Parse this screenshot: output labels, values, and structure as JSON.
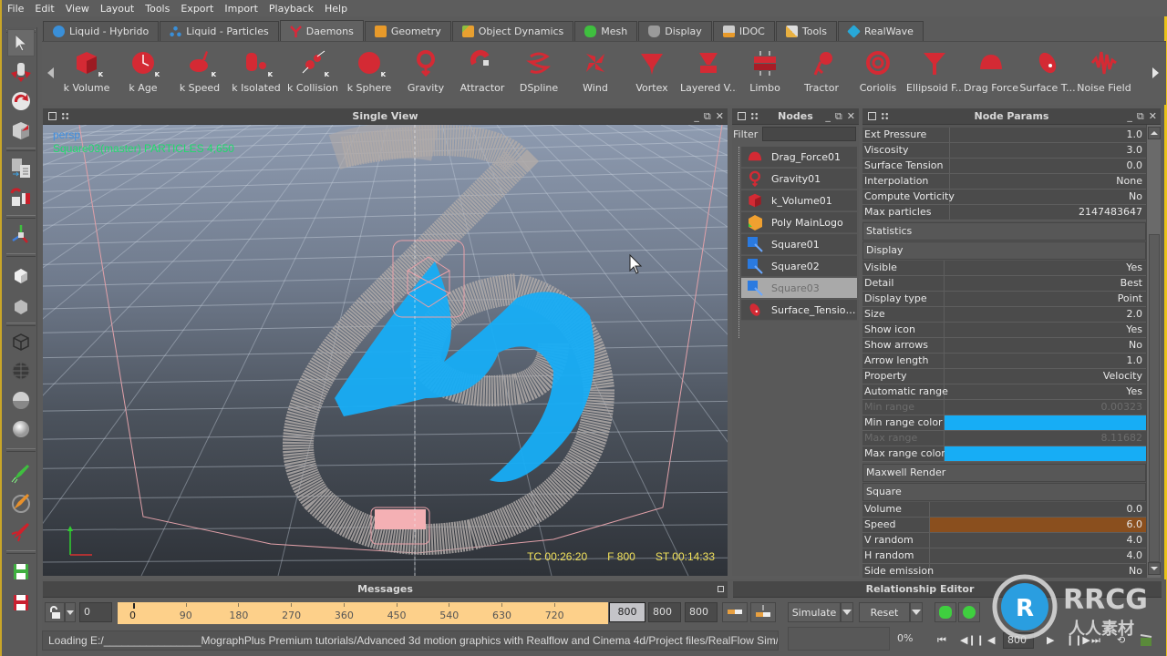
{
  "menu": [
    "File",
    "Edit",
    "View",
    "Layout",
    "Tools",
    "Export",
    "Import",
    "Playback",
    "Help"
  ],
  "tabs": [
    {
      "label": "Liquid - Hybrido",
      "icon": "hybrido-icon",
      "color": "#3a8fd8"
    },
    {
      "label": "Liquid - Particles",
      "icon": "particles-icon",
      "color": "#3a8fd8"
    },
    {
      "label": "Daemons",
      "icon": "daemons-icon",
      "color": "#d8283a",
      "active": true
    },
    {
      "label": "Geometry",
      "icon": "geometry-icon",
      "color": "#e89a2a"
    },
    {
      "label": "Object Dynamics",
      "icon": "object-dynamics-icon",
      "color": "#e8a030"
    },
    {
      "label": "Mesh",
      "icon": "mesh-icon",
      "color": "#3fbf3f"
    },
    {
      "label": "Display",
      "icon": "display-icon",
      "color": "#9a9a9a"
    },
    {
      "label": "IDOC",
      "icon": "idoc-icon",
      "color": "#bdbdbd"
    },
    {
      "label": "Tools",
      "icon": "tools-icon",
      "color": "#e8b040"
    },
    {
      "label": "RealWave",
      "icon": "realwave-icon",
      "color": "#28a8d8"
    }
  ],
  "daemons": [
    {
      "label": "k Volume",
      "icon": "k-volume-icon",
      "k": true
    },
    {
      "label": "k Age",
      "icon": "k-age-icon",
      "k": true
    },
    {
      "label": "k Speed",
      "icon": "k-speed-icon",
      "k": true
    },
    {
      "label": "k Isolated",
      "icon": "k-isolated-icon",
      "k": true
    },
    {
      "label": "k Collision",
      "icon": "k-collision-icon",
      "k": true
    },
    {
      "label": "k Sphere",
      "icon": "k-sphere-icon",
      "k": true
    },
    {
      "label": "Gravity",
      "icon": "gravity-icon"
    },
    {
      "label": "Attractor",
      "icon": "attractor-icon"
    },
    {
      "label": "DSpline",
      "icon": "dspline-icon"
    },
    {
      "label": "Wind",
      "icon": "wind-icon"
    },
    {
      "label": "Vortex",
      "icon": "vortex-icon"
    },
    {
      "label": "Layered V...",
      "icon": "layered-vortex-icon"
    },
    {
      "label": "Limbo",
      "icon": "limbo-icon"
    },
    {
      "label": "Tractor",
      "icon": "tractor-icon"
    },
    {
      "label": "Coriolis",
      "icon": "coriolis-icon"
    },
    {
      "label": "Ellipsoid F...",
      "icon": "ellipsoid-force-icon"
    },
    {
      "label": "Drag Force",
      "icon": "drag-force-icon"
    },
    {
      "label": "Surface T...",
      "icon": "surface-tension-icon"
    },
    {
      "label": "Noise Field",
      "icon": "noise-field-icon"
    }
  ],
  "k_badge": "K",
  "viewport": {
    "title": "Single View",
    "camera": "persp",
    "particles_info": "Square03(master) PARTICLES 4,650",
    "timecode": "TC 00:26:20",
    "frame": "F 800",
    "sim_time": "ST 00:14:33"
  },
  "nodes": {
    "title": "Nodes",
    "filter_label": "Filter",
    "filter_value": "",
    "items": [
      {
        "label": "Drag_Force01",
        "icon": "drag-force-icon"
      },
      {
        "label": "Gravity01",
        "icon": "gravity-icon"
      },
      {
        "label": "k_Volume01",
        "icon": "k-volume-icon"
      },
      {
        "label": "Poly MainLogo",
        "icon": "poly-object-icon"
      },
      {
        "label": "Square01",
        "icon": "square-emitter-icon"
      },
      {
        "label": "Square02",
        "icon": "square-emitter-icon"
      },
      {
        "label": "Square03",
        "icon": "square-emitter-icon",
        "selected": true
      },
      {
        "label": "Surface_Tension...",
        "icon": "surface-tension-icon"
      }
    ]
  },
  "params": {
    "title": "Node Params",
    "rows_top": [
      {
        "key": "Ext Pressure",
        "value": "1.0"
      },
      {
        "key": "Viscosity",
        "value": "3.0"
      },
      {
        "key": "Surface Tension",
        "value": "0.0"
      },
      {
        "key": "Interpolation",
        "value": "None"
      },
      {
        "key": "Compute Vorticity",
        "value": "No"
      },
      {
        "key": "Max particles",
        "value": "2147483647"
      }
    ],
    "section_statistics": "Statistics",
    "section_display": "Display",
    "rows_display": [
      {
        "key": "Visible",
        "value": "Yes"
      },
      {
        "key": "Detail",
        "value": "Best"
      },
      {
        "key": "Display type",
        "value": "Point"
      },
      {
        "key": "Size",
        "value": "2.0"
      },
      {
        "key": "Show icon",
        "value": "Yes"
      },
      {
        "key": "Show arrows",
        "value": "No"
      },
      {
        "key": "Arrow length",
        "value": "1.0"
      },
      {
        "key": "Property",
        "value": "Velocity"
      },
      {
        "key": "Automatic range",
        "value": "Yes"
      },
      {
        "key": "Min range",
        "value": "0.00323",
        "dim": true
      },
      {
        "key": "Min range color",
        "value": "",
        "color": "#17adf5"
      },
      {
        "key": "Max range",
        "value": "8.11682",
        "dim": true
      },
      {
        "key": "Max range color",
        "value": "",
        "color": "#17adf5"
      }
    ],
    "section_maxwell": "Maxwell Render",
    "section_square": "Square",
    "rows_square": [
      {
        "key": "Volume",
        "value": "0.0"
      },
      {
        "key": "Speed",
        "value": "6.0",
        "highlight": "#8a4f1e"
      },
      {
        "key": "V random",
        "value": "4.0"
      },
      {
        "key": "H random",
        "value": "4.0"
      },
      {
        "key": "Side emission",
        "value": "No"
      }
    ]
  },
  "messages": {
    "title": "Messages"
  },
  "relationship": {
    "title": "Relationship Editor"
  },
  "timeline": {
    "start_field": "0",
    "ticks": [
      "0",
      "90",
      "180",
      "270",
      "360",
      "450",
      "540",
      "630",
      "720"
    ],
    "current_frame": "800",
    "end_field_1": "800",
    "end_field_2": "800"
  },
  "sim": {
    "simulate_label": "Simulate",
    "reset_label": "Reset",
    "progress": "0%",
    "frame_field": "800"
  },
  "status": {
    "text": "Loading E:/________________MographPlus Premium tutorials/Advanced 3d motion graphics with Realflow and Cinema 4d/Project files/RealFlow Sim/Fluid Sim..."
  },
  "watermark": {
    "brand": "RRCG",
    "subtitle": "人人素材"
  },
  "colors": {
    "accent_daemon_red": "#d42a34",
    "particle_blue": "#17adf5",
    "particle_grey": "#b0aaa8",
    "timeline_orange": "#fdd08a",
    "hud_green": "#1fdb6c",
    "hud_yellow": "#f0e05a"
  }
}
